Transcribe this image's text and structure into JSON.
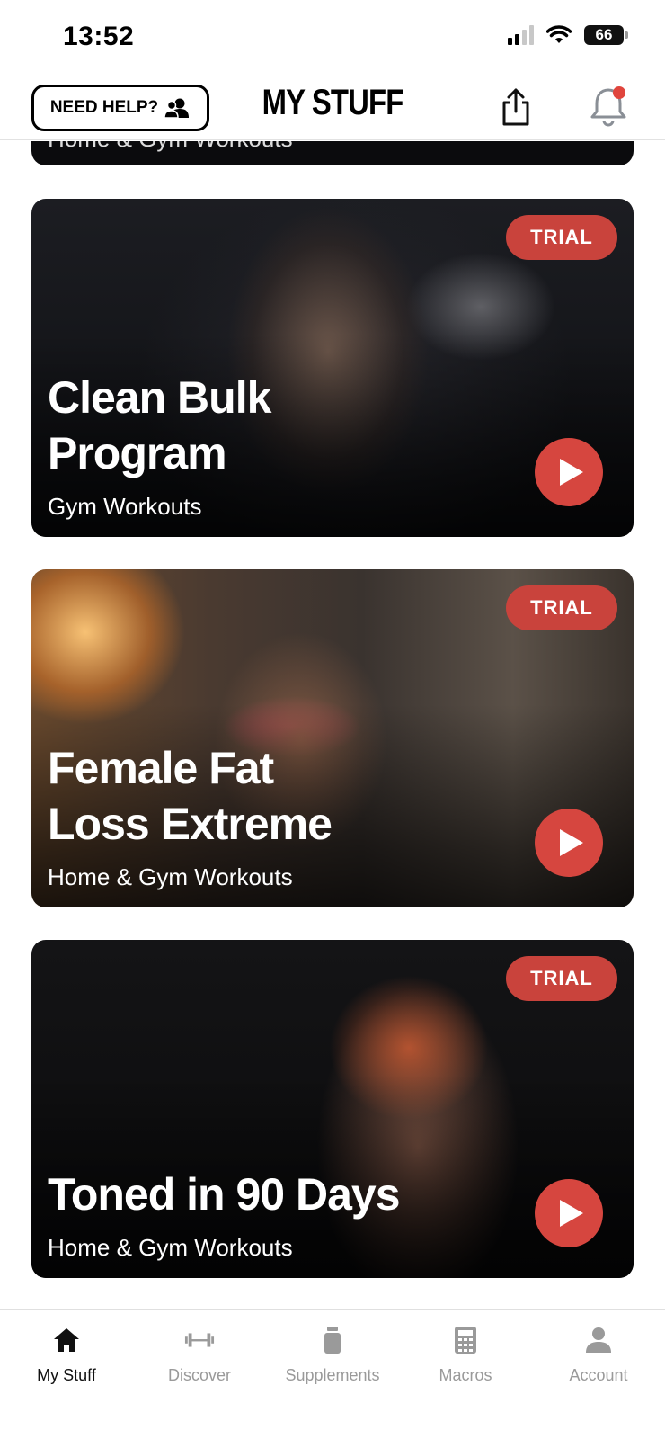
{
  "status_bar": {
    "time": "13:52",
    "battery": "66"
  },
  "header": {
    "help_label": "NEED HELP?",
    "title": "MY STUFF"
  },
  "cards": [
    {
      "title": "",
      "subtitle": "Home & Gym Workouts"
    },
    {
      "title_line1": "Clean Bulk",
      "title_line2": "Program",
      "subtitle": "Gym Workouts",
      "badge": "TRIAL"
    },
    {
      "title_line1": "Female Fat",
      "title_line2": "Loss Extreme",
      "subtitle": "Home & Gym Workouts",
      "badge": "TRIAL"
    },
    {
      "title_line1": "Toned in 90 Days",
      "subtitle": "Home & Gym Workouts",
      "badge": "TRIAL"
    }
  ],
  "tabs": [
    {
      "label": "My Stuff",
      "icon": "home-icon",
      "active": true
    },
    {
      "label": "Discover",
      "icon": "dumbbell-icon",
      "active": false
    },
    {
      "label": "Supplements",
      "icon": "supplement-bottle-icon",
      "active": false
    },
    {
      "label": "Macros",
      "icon": "calculator-icon",
      "active": false
    },
    {
      "label": "Account",
      "icon": "person-icon",
      "active": false
    }
  ],
  "colors": {
    "accent_red": "#d6463f",
    "badge_red": "#c9433c",
    "tab_inactive": "#9a9a9a"
  }
}
